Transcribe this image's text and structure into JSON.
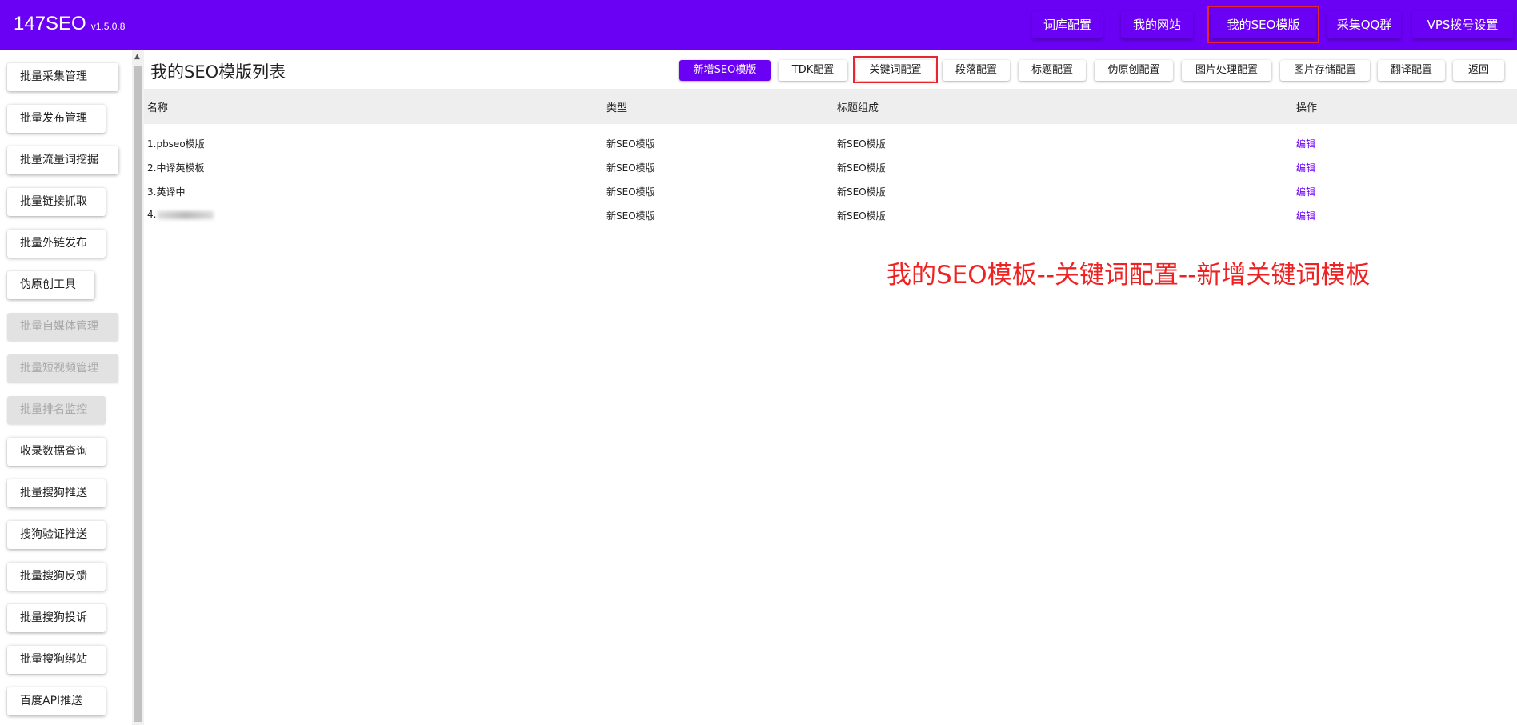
{
  "brand": {
    "name": "147SEO",
    "version": "v1.5.0.8"
  },
  "topnav": [
    {
      "label": "词库配置"
    },
    {
      "label": "我的网站"
    },
    {
      "label": "我的SEO模版"
    },
    {
      "label": "采集QQ群"
    },
    {
      "label": "VPS拨号设置"
    }
  ],
  "sidebar": [
    {
      "label": "批量采集管理",
      "disabled": false
    },
    {
      "label": "批量发布管理",
      "disabled": false
    },
    {
      "label": "批量流量词挖掘",
      "disabled": false
    },
    {
      "label": "批量链接抓取",
      "disabled": false
    },
    {
      "label": "批量外链发布",
      "disabled": false
    },
    {
      "label": "伪原创工具",
      "disabled": false
    },
    {
      "label": "批量自媒体管理",
      "disabled": true
    },
    {
      "label": "批量短视频管理",
      "disabled": true
    },
    {
      "label": "批量排名监控",
      "disabled": true
    },
    {
      "label": "收录数据查询",
      "disabled": false
    },
    {
      "label": "批量搜狗推送",
      "disabled": false
    },
    {
      "label": "搜狗验证推送",
      "disabled": false
    },
    {
      "label": "批量搜狗反馈",
      "disabled": false
    },
    {
      "label": "批量搜狗投诉",
      "disabled": false
    },
    {
      "label": "批量搜狗绑站",
      "disabled": false
    },
    {
      "label": "百度API推送",
      "disabled": false
    }
  ],
  "main": {
    "title": "我的SEO模版列表",
    "toolbar": [
      {
        "label": "新增SEO模版"
      },
      {
        "label": "TDK配置"
      },
      {
        "label": "关键词配置"
      },
      {
        "label": "段落配置"
      },
      {
        "label": "标题配置"
      },
      {
        "label": "伪原创配置"
      },
      {
        "label": "图片处理配置"
      },
      {
        "label": "图片存储配置"
      },
      {
        "label": "翻译配置"
      },
      {
        "label": "返回"
      }
    ],
    "columns": [
      "名称",
      "类型",
      "标题组成",
      "操作"
    ],
    "rows": [
      {
        "name": "1.pbseo模版",
        "type": "新SEO模版",
        "title_comp": "新SEO模版",
        "action": "编辑"
      },
      {
        "name": "2.中译英模板",
        "type": "新SEO模版",
        "title_comp": "新SEO模版",
        "action": "编辑"
      },
      {
        "name": "3.英译中",
        "type": "新SEO模版",
        "title_comp": "新SEO模版",
        "action": "编辑"
      },
      {
        "name": "4.",
        "type": "新SEO模版",
        "title_comp": "新SEO模版",
        "action": "编辑"
      }
    ]
  },
  "annotation": "我的SEO模板--关键词配置--新增关键词模板",
  "colors": {
    "accent": "#6a00f4",
    "highlight": "#e8262b",
    "annotation": "#ee2222"
  }
}
